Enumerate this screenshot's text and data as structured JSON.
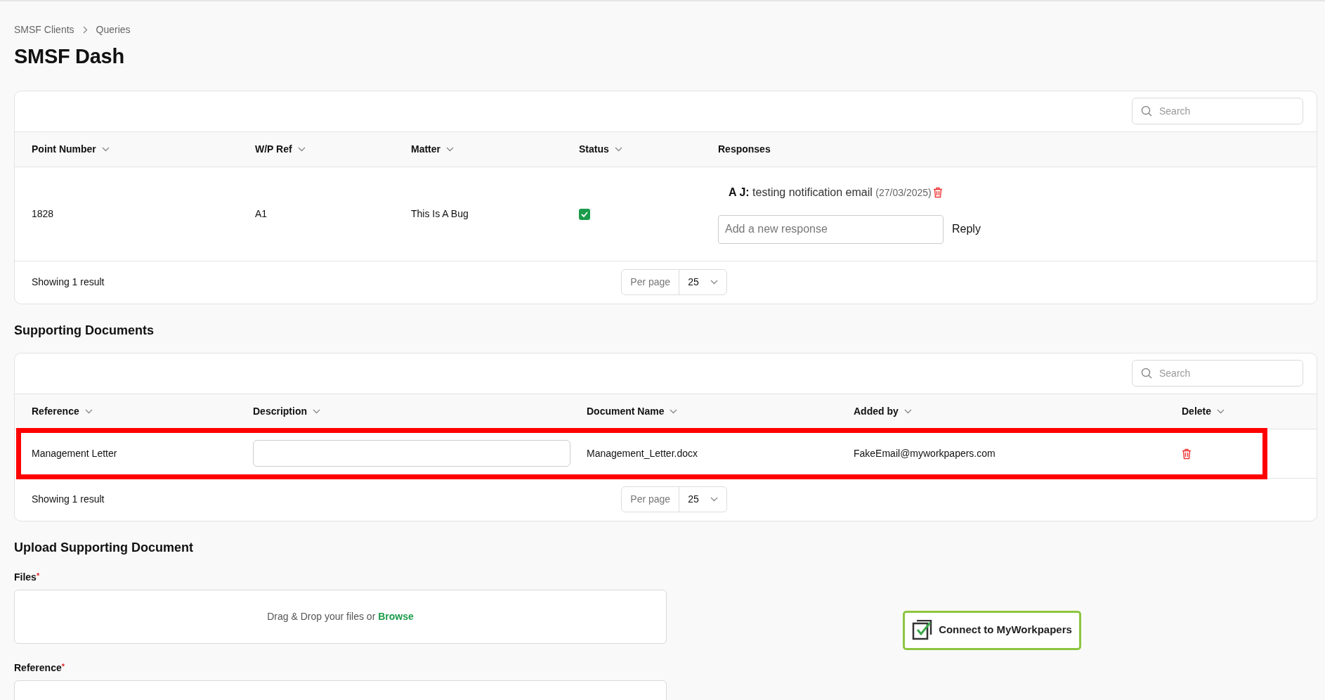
{
  "breadcrumb": [
    "SMSF Clients",
    "Queries"
  ],
  "title": "SMSF Dash",
  "queries": {
    "search": {
      "placeholder": "Search"
    },
    "columns": [
      {
        "label": "Point Number",
        "sortable": true
      },
      {
        "label": "W/P Ref",
        "sortable": true
      },
      {
        "label": "Matter",
        "sortable": true
      },
      {
        "label": "Status",
        "sortable": true
      },
      {
        "label": "Responses",
        "sortable": false
      }
    ],
    "rows": [
      {
        "point_number": "1828",
        "wp_ref": "A1",
        "matter": "This Is A Bug",
        "checked": true,
        "responses": [
          {
            "author": "A J:",
            "text": "testing notification email",
            "date": "(27/03/2025)"
          }
        ],
        "reply_placeholder": "Add a new response",
        "reply_button": "Reply"
      }
    ],
    "footer": {
      "summary": "Showing 1 result",
      "per_page_label": "Per page",
      "per_page": "25"
    }
  },
  "documents": {
    "heading": "Supporting Documents",
    "search": {
      "placeholder": "Search"
    },
    "columns": [
      {
        "label": "Reference",
        "sortable": true
      },
      {
        "label": "Description",
        "sortable": true
      },
      {
        "label": "Document Name",
        "sortable": true
      },
      {
        "label": "Added by",
        "sortable": true
      },
      {
        "label": "Delete",
        "sortable": true
      }
    ],
    "rows": [
      {
        "reference": "Management Letter",
        "document_name": "Management_Letter.docx",
        "added_by": "FakeEmail@myworkpapers.com",
        "highlighted": true
      }
    ],
    "footer": {
      "summary": "Showing 1 result",
      "per_page_label": "Per page",
      "per_page": "25"
    }
  },
  "upload": {
    "heading": "Upload Supporting Document",
    "fields": [
      {
        "kind": "dropzone",
        "label": "Files",
        "required_mark": "*",
        "prompt": "Drag & Drop your files or",
        "link": "Browse"
      },
      {
        "kind": "text",
        "label": "Reference",
        "required_mark": "*"
      }
    ],
    "connect_button": "Connect to MyWorkpapers"
  }
}
